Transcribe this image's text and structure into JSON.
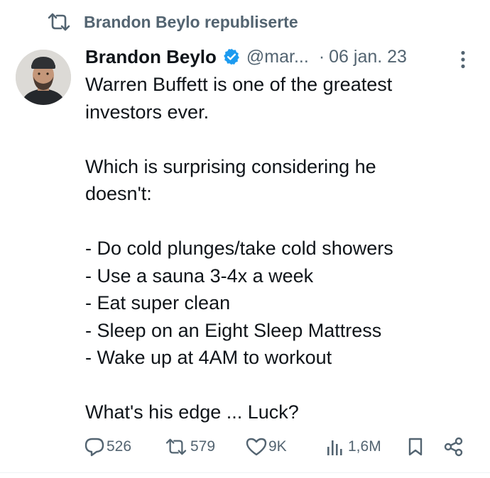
{
  "repost": {
    "label": "Brandon Beylo republiserte",
    "icon": "repost-icon"
  },
  "author": {
    "display_name": "Brandon Beylo",
    "verified_icon": "verified-badge-icon",
    "handle": "@mar...",
    "separator": "·",
    "date": "06 jan. 23"
  },
  "tweet": {
    "lines": [
      "Warren Buffett is one of the greatest",
      "investors ever.",
      "",
      "Which is surprising considering he",
      "doesn't:",
      "",
      "- Do cold plunges/take cold showers",
      "- Use a sauna 3-4x a week",
      "- Eat super clean",
      "- Sleep on an Eight Sleep Mattress",
      "- Wake up at 4AM to workout",
      "",
      "What's his edge ... Luck?"
    ]
  },
  "actions": {
    "replies": "526",
    "reposts": "579",
    "likes": "9K",
    "views": "1,6M"
  },
  "colors": {
    "secondary_text": "#536471",
    "primary_text": "#0f1419",
    "verified_blue": "#1d9bf0"
  }
}
